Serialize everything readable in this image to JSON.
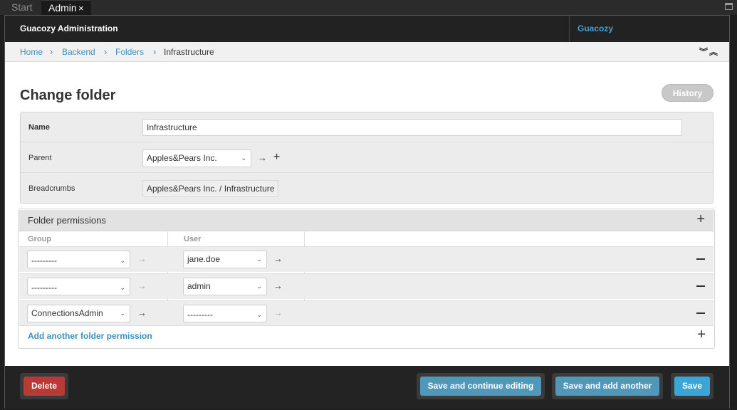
{
  "tabs": {
    "start": "Start",
    "admin": "Admin",
    "close": "×"
  },
  "header": {
    "title": "Guacozy Administration",
    "user": "Guacozy"
  },
  "breadcrumbs": {
    "home": "Home",
    "backend": "Backend",
    "folders": "Folders",
    "current": "Infrastructure",
    "sep": "›",
    "tools": "︾︽"
  },
  "page": {
    "title": "Change folder",
    "history": "History"
  },
  "form": {
    "name_label": "Name",
    "name_value": "Infrastructure",
    "parent_label": "Parent",
    "parent_value": "Apples&Pears Inc.",
    "breadcrumbs_label": "Breadcrumbs",
    "breadcrumbs_value": "Apples&Pears Inc. / Infrastructure"
  },
  "permissions": {
    "title": "Folder permissions",
    "col_group": "Group",
    "col_user": "User",
    "rows": [
      {
        "group": "---------",
        "user": "jane.doe"
      },
      {
        "group": "---------",
        "user": "admin"
      },
      {
        "group": "ConnectionsAdmin",
        "user": "---------"
      }
    ],
    "add_label": "Add another folder permission"
  },
  "footer": {
    "delete": "Delete",
    "save_continue": "Save and continue editing",
    "save_add": "Save and add another",
    "save": "Save"
  },
  "icons": {
    "arrow": "→",
    "plus": "+",
    "caret": "⌄"
  }
}
